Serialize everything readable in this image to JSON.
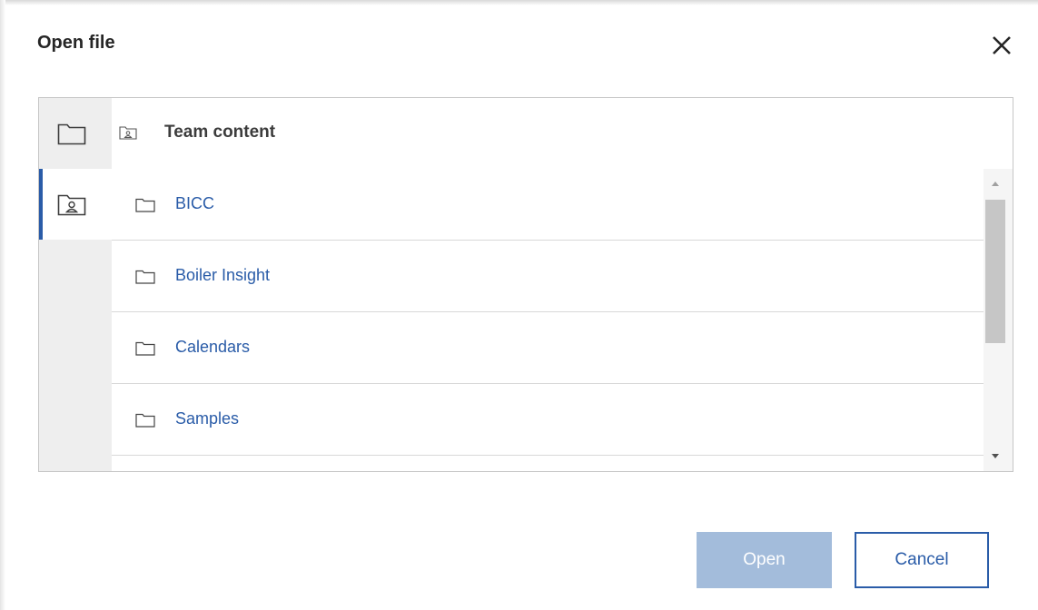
{
  "dialog": {
    "title": "Open file",
    "close_icon": "close-icon"
  },
  "rail": [
    {
      "icon": "folder-icon",
      "selected": false
    },
    {
      "icon": "team-folder-icon",
      "selected": true
    }
  ],
  "header": {
    "icon": "team-folder-icon",
    "title": "Team content"
  },
  "items": [
    {
      "label": "BICC",
      "icon": "folder-icon"
    },
    {
      "label": "Boiler Insight",
      "icon": "folder-icon"
    },
    {
      "label": "Calendars",
      "icon": "folder-icon"
    },
    {
      "label": "Samples",
      "icon": "folder-icon"
    }
  ],
  "buttons": {
    "open_label": "Open",
    "cancel_label": "Cancel"
  },
  "colors": {
    "accent": "#2a5ca8",
    "disabled_primary": "#a3bcdb",
    "rail_bg": "#eeeeee"
  }
}
